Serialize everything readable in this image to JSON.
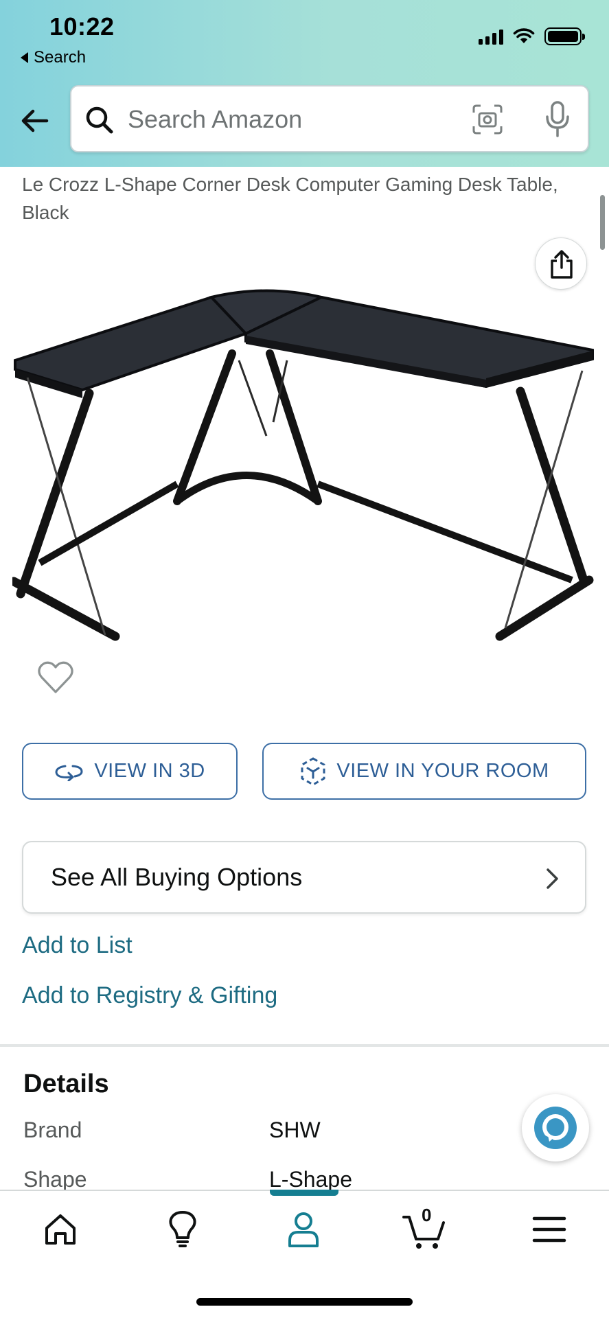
{
  "status_bar": {
    "time": "10:22",
    "back_app": "Search"
  },
  "search": {
    "placeholder": "Search Amazon"
  },
  "product": {
    "title": "Le Crozz L-Shape Corner Desk Computer Gaming Desk Table, Black"
  },
  "actions": {
    "view_3d": "VIEW IN 3D",
    "view_room": "VIEW IN YOUR ROOM",
    "buying_options": "See All Buying Options",
    "add_to_list": "Add to List",
    "add_to_registry": "Add to Registry & Gifting"
  },
  "details": {
    "heading": "Details",
    "rows": [
      {
        "key": "Brand",
        "value": "SHW"
      },
      {
        "key": "Shape",
        "value": "L-Shape"
      }
    ]
  },
  "bottom_nav": {
    "active": "you",
    "cart_count": "0",
    "items": [
      "home-icon",
      "lightbulb-icon",
      "person-icon",
      "cart-icon",
      "menu-icon"
    ]
  },
  "colors": {
    "header_gradient_start": "#84d2dc",
    "header_gradient_end": "#a8e4d6",
    "link": "#1d6b82",
    "button_outline": "#3d6fa6",
    "active_tab": "#157e91"
  }
}
